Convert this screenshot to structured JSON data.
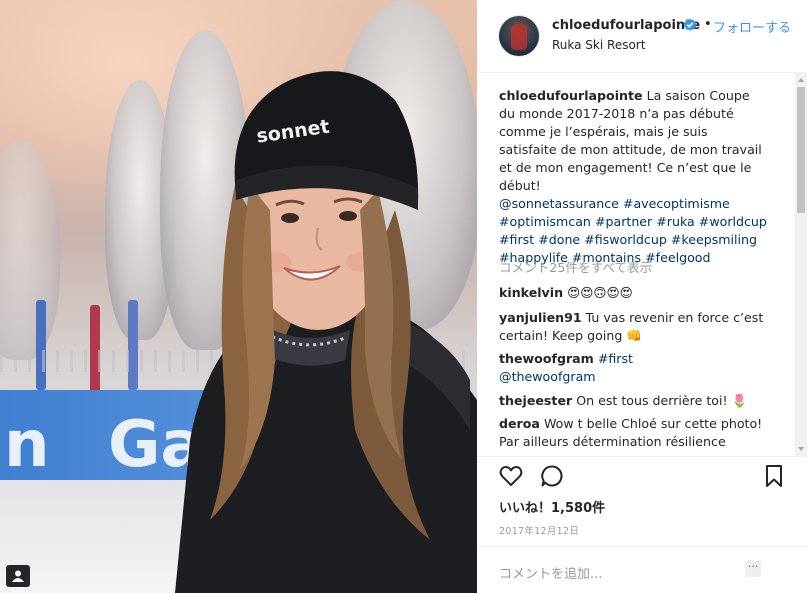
{
  "post": {
    "username": "chloedufourlapointe",
    "location": "Ruka Ski Resort",
    "follow_label": "フォローする",
    "separator": "•"
  },
  "caption": {
    "username": "chloedufourlapointe",
    "text": "La saison Coupe du monde 2017-2018 n’a pas débuté comme je l’espérais, mais je suis satisfaite de mon attitude, de mon travail et de mon engagement! Ce n’est que le début!",
    "tags": [
      "@sonnetassurance",
      "#avecoptimisme",
      "#optimismcan",
      "#partner",
      "#ruka",
      "#worldcup",
      "#first",
      "#done",
      "#fisworldcup",
      "#keepsmiling",
      "#happylife",
      "#montains",
      "#feelgood"
    ]
  },
  "view_all_comments": "コメント25件をすべて表示",
  "comments": [
    {
      "user": "kinkelvin",
      "text": "😍😍🙃😍😍"
    },
    {
      "user": "yanjulien91",
      "text": "Tu vas revenir en force c’est certain! Keep going 👊"
    },
    {
      "user": "thewoofgram",
      "text": "#first",
      "tag2": "@thewoofgram"
    },
    {
      "user": "thejeester",
      "text": "On est tous derrière toi! 🌷"
    },
    {
      "user": "deroa",
      "text": "Wow t belle Chloé sur cette photo! Par ailleurs détermination résilience"
    }
  ],
  "likes_label": "いいね！1,580件",
  "date": "2017年12月12日",
  "add_comment_placeholder": "コメントを追加...",
  "more_label": "···",
  "photo": {
    "hat_text": "sonnet",
    "banner_text_left": "n",
    "banner_text_right": "Gas"
  },
  "icons": {
    "heart": "heart-icon",
    "comment": "comment-icon",
    "save": "bookmark-icon",
    "verified": "verified-badge-icon",
    "tag_people": "person-tag-icon"
  },
  "colors": {
    "link": "#003569",
    "follow": "#3897f0",
    "verified": "#3897f0",
    "muted": "#999999"
  }
}
